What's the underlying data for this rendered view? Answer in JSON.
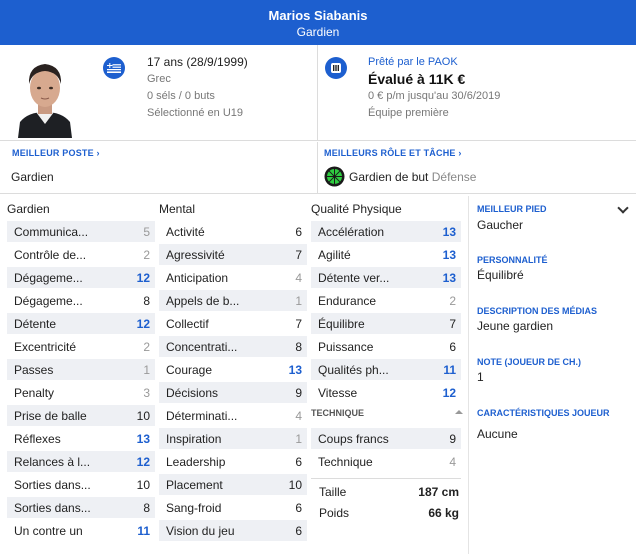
{
  "header": {
    "name": "Marios Siabanis",
    "position": "Gardien"
  },
  "profile": {
    "age": "17 ans (28/9/1999)",
    "nationality": "Grec",
    "caps": "0 séls / 0 buts",
    "selection": "Sélectionné en U19",
    "loan": "Prêté par le PAOK",
    "value": "Évalué à 11K €",
    "contract": "0 € p/m jusqu'au 30/6/2019",
    "squad": "Équipe première"
  },
  "best": {
    "position_label": "MEILLEUR POSTE",
    "position_value": "Gardien",
    "role_label": "MEILLEURS RÔLE ET TÂCHE",
    "role_value": "Gardien de but",
    "duty_value": "Défense"
  },
  "columns": {
    "gk": {
      "title": "Gardien",
      "attrs": [
        {
          "label": "Communica...",
          "value": "5"
        },
        {
          "label": "Contrôle de...",
          "value": "2"
        },
        {
          "label": "Dégageme...",
          "value": "12"
        },
        {
          "label": "Dégageme...",
          "value": "8"
        },
        {
          "label": "Détente",
          "value": "12"
        },
        {
          "label": "Excentricité",
          "value": "2"
        },
        {
          "label": "Passes",
          "value": "1"
        },
        {
          "label": "Penalty",
          "value": "3"
        },
        {
          "label": "Prise de balle",
          "value": "10"
        },
        {
          "label": "Réflexes",
          "value": "13"
        },
        {
          "label": "Relances à l...",
          "value": "12"
        },
        {
          "label": "Sorties dans...",
          "value": "10"
        },
        {
          "label": "Sorties dans...",
          "value": "8"
        },
        {
          "label": "Un contre un",
          "value": "11"
        }
      ]
    },
    "mental": {
      "title": "Mental",
      "attrs": [
        {
          "label": "Activité",
          "value": "6"
        },
        {
          "label": "Agressivité",
          "value": "7"
        },
        {
          "label": "Anticipation",
          "value": "4"
        },
        {
          "label": "Appels de b...",
          "value": "1"
        },
        {
          "label": "Collectif",
          "value": "7"
        },
        {
          "label": "Concentrati...",
          "value": "8"
        },
        {
          "label": "Courage",
          "value": "13"
        },
        {
          "label": "Décisions",
          "value": "9"
        },
        {
          "label": "Déterminati...",
          "value": "4"
        },
        {
          "label": "Inspiration",
          "value": "1"
        },
        {
          "label": "Leadership",
          "value": "6"
        },
        {
          "label": "Placement",
          "value": "10"
        },
        {
          "label": "Sang-froid",
          "value": "6"
        },
        {
          "label": "Vision du jeu",
          "value": "6"
        }
      ]
    },
    "physical": {
      "title": "Qualité Physique",
      "attrs": [
        {
          "label": "Accélération",
          "value": "13"
        },
        {
          "label": "Agilité",
          "value": "13"
        },
        {
          "label": "Détente ver...",
          "value": "13"
        },
        {
          "label": "Endurance",
          "value": "2"
        },
        {
          "label": "Équilibre",
          "value": "7"
        },
        {
          "label": "Puissance",
          "value": "6"
        },
        {
          "label": "Qualités ph...",
          "value": "11"
        },
        {
          "label": "Vitesse",
          "value": "12"
        }
      ],
      "technique_title": "TECHNIQUE",
      "technique": [
        {
          "label": "Coups francs",
          "value": "9"
        },
        {
          "label": "Technique",
          "value": "4"
        }
      ],
      "height_label": "Taille",
      "height_value": "187 cm",
      "weight_label": "Poids",
      "weight_value": "66 kg"
    }
  },
  "side": {
    "foot_label": "MEILLEUR PIED",
    "foot_value": "Gaucher",
    "personality_label": "PERSONNALITÉ",
    "personality_value": "Équilibré",
    "media_label": "DESCRIPTION DES MÉDIAS",
    "media_value": "Jeune gardien",
    "rating_label": "NOTE (JOUEUR DE CH.)",
    "rating_value": "1",
    "traits_label": "CARACTÉRISTIQUES JOUEUR",
    "traits_value": "Aucune"
  },
  "colors": {
    "accent": "#1d5fcf",
    "row_shade": "#eef0f4"
  }
}
